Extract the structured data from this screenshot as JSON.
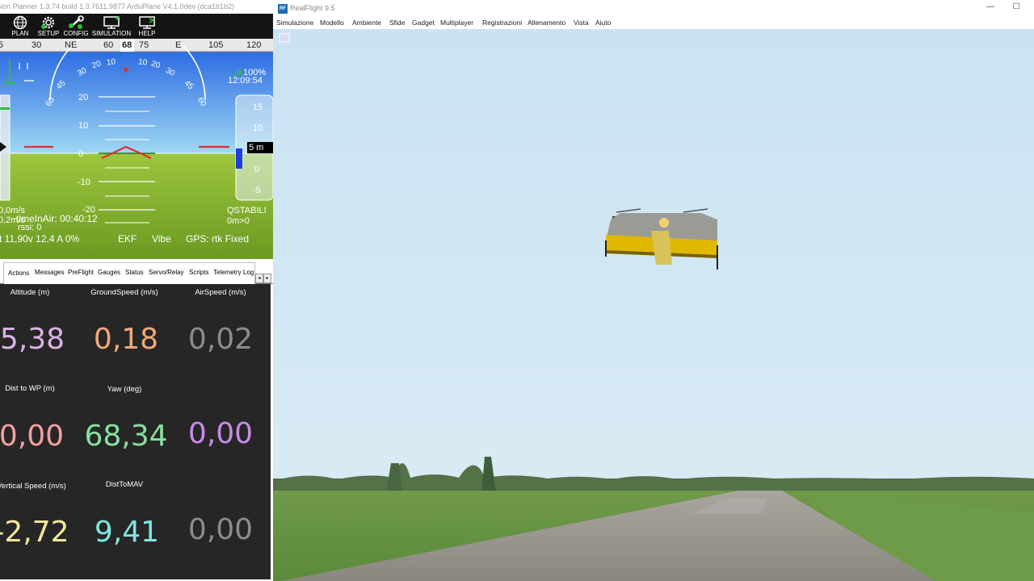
{
  "mission_planner": {
    "title": "ssion Planner 1.3.74 build 1.3.7611.9877 ArduPlane V4.1.0dev (dca1b1b2)",
    "toolbar": [
      {
        "label": "PLAN",
        "icon": "globe-icon"
      },
      {
        "label": "SETUP",
        "icon": "gear-icon"
      },
      {
        "label": "CONFIG",
        "icon": "wrench-icon"
      },
      {
        "label": "SIMULATION",
        "icon": "monitor-icon"
      },
      {
        "label": "HELP",
        "icon": "help-icon"
      }
    ],
    "hud": {
      "heading_ticks": [
        "5",
        "30",
        "NE",
        "60",
        "68",
        "75",
        "E",
        "105",
        "120"
      ],
      "roll_scale": [
        "60",
        "45",
        "30",
        "20",
        "10",
        "0",
        "10",
        "20",
        "30",
        "45",
        "60"
      ],
      "pitch_scale": [
        "20",
        "10",
        "0",
        "-10",
        "-20"
      ],
      "altitude_ticks": [
        "15",
        "10",
        "0",
        "-5"
      ],
      "altitude_box": "5 m",
      "battery_percent": "100%",
      "clock": "12:09:54",
      "speed_text": "0,0m/s",
      "speed_text2": "0,2m/s",
      "time_in_air": "timeInAir: 00:40:12",
      "rssi": "rssi: 0",
      "flight_mode": "QSTABILI",
      "wp_dist": "0m>0",
      "battery": "t 11,90v 12,4 A 0%",
      "ekf": "EKF",
      "vibe": "Vibe",
      "gps": "GPS: rtk Fixed"
    },
    "tabs": [
      "Actions",
      "Messages",
      "PreFlight",
      "Gauges",
      "Status",
      "Servo/Relay",
      "Scripts",
      "Telemetry Logs"
    ],
    "active_tab": "Actions",
    "quick_view": [
      {
        "label": "Altitude (m)",
        "value": "5,38",
        "color": "#d9b3e6"
      },
      {
        "label": "GroundSpeed (m/s)",
        "value": "0,18",
        "color": "#f0a878"
      },
      {
        "label": "AirSpeed (m/s)",
        "value": "0,02",
        "color": "#8c8c8c"
      },
      {
        "label": "Dist to WP (m)",
        "value": "0,00",
        "color": "#f4a0a0"
      },
      {
        "label": "Yaw (deg)",
        "value": "68,34",
        "color": "#88e0a0"
      },
      {
        "label": "",
        "value": "0,00",
        "color": "#c88be8"
      },
      {
        "label": "Vertical Speed (m/s)",
        "value": "-2,72",
        "color": "#f0e89a"
      },
      {
        "label": "DistToMAV",
        "value": "9,41",
        "color": "#7ee6e0"
      },
      {
        "label": "",
        "value": "0,00",
        "color": "#8c8c8c"
      }
    ]
  },
  "realflight": {
    "title": "RealFlight 9.5",
    "logo": "RF",
    "menu": [
      "Simulazione",
      "Modello",
      "Ambiente",
      "Sfide",
      "Gadget",
      "Multiplayer",
      "Registrazioni",
      "Allenamento",
      "Vista",
      "Aiuto"
    ],
    "window_controls": {
      "minimize": "—",
      "maximize": "☐"
    }
  }
}
